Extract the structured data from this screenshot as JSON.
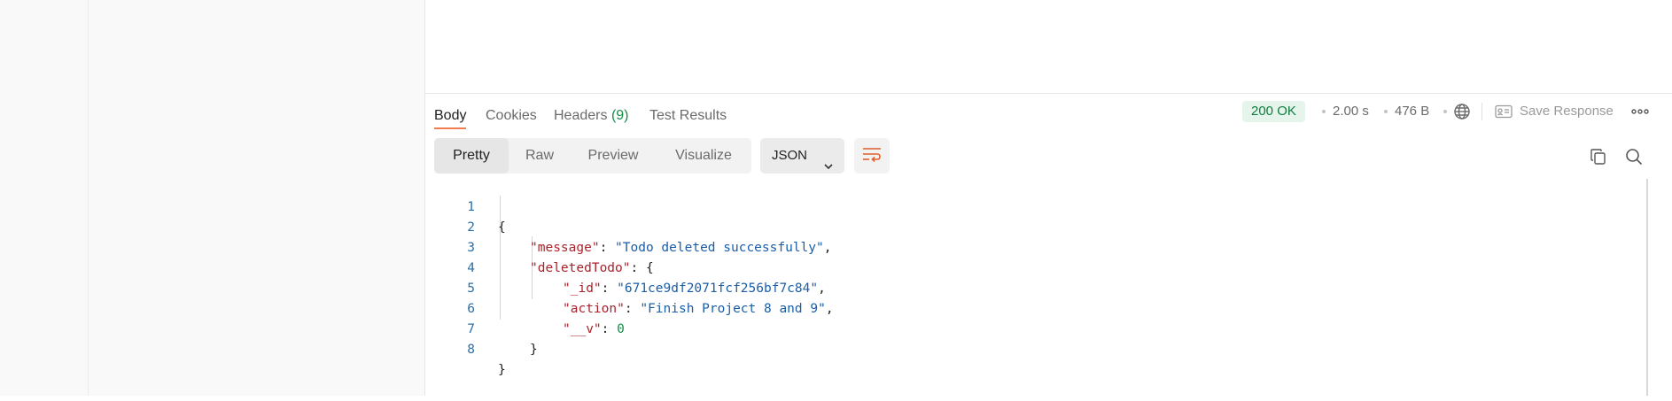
{
  "response": {
    "tabs": [
      {
        "label": "Body"
      },
      {
        "label": "Cookies"
      },
      {
        "label": "Headers",
        "count": "(9)"
      },
      {
        "label": "Test Results"
      }
    ],
    "status": "200 OK",
    "time": "2.00 s",
    "size": "476 B",
    "save_label": "Save Response",
    "view_modes": [
      "Pretty",
      "Raw",
      "Preview",
      "Visualize"
    ],
    "format": "JSON",
    "icons": {
      "globe": "globe-icon",
      "save": "save-response-icon",
      "more": "more-icon",
      "wrap": "wrap-lines-icon",
      "copy": "copy-icon",
      "search": "search-icon"
    },
    "colors": {
      "status_bg": "#e5f5ec",
      "status_text": "#0f7d3d",
      "active_tab_underline": "#f07d4f",
      "json_key": "#a8232c",
      "json_string": "#1b5ea8",
      "json_number": "#168c49"
    }
  },
  "body_lines": [
    {
      "num": "1",
      "text": "{"
    },
    {
      "num": "2",
      "key": "\"message\"",
      "value": "\"Todo deleted successfully\"",
      "tail": ","
    },
    {
      "num": "3",
      "key": "\"deletedTodo\"",
      "tail": ": {"
    },
    {
      "num": "4",
      "key": "\"_id\"",
      "value": "\"671ce9df2071fcf256bf7c84\"",
      "tail": ","
    },
    {
      "num": "5",
      "key": "\"action\"",
      "value": "\"Finish Project 8 and 9\"",
      "tail": ","
    },
    {
      "num": "6",
      "key": "\"__v\"",
      "number": "0"
    },
    {
      "num": "7",
      "text": "}"
    },
    {
      "num": "8",
      "text": "}"
    }
  ]
}
